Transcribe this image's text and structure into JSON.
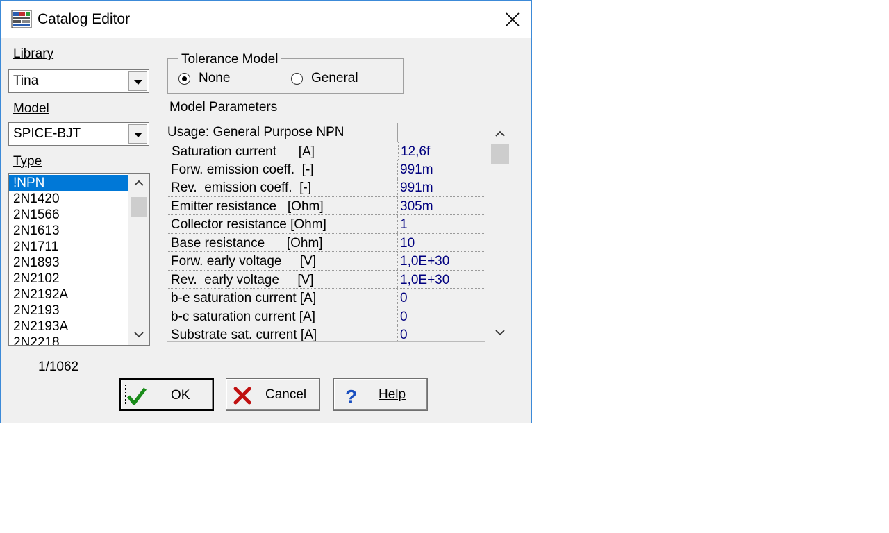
{
  "window": {
    "title": "Catalog Editor"
  },
  "library": {
    "label": "Library",
    "value": "Tina"
  },
  "model": {
    "label": "Model",
    "value": "SPICE-BJT"
  },
  "type": {
    "label": "Type",
    "items": [
      "!NPN",
      "2N1420",
      "2N1566",
      "2N1613",
      "2N1711",
      "2N1893",
      "2N2102",
      "2N2192A",
      "2N2193",
      "2N2193A",
      "2N2218"
    ],
    "selected_index": 0
  },
  "counter": "1/1062",
  "tolerance": {
    "title": "Tolerance Model",
    "none_label": "None",
    "general_label": "General",
    "selected": "None"
  },
  "params": {
    "label": "Model Parameters",
    "header": "Usage: General Purpose NPN",
    "rows": [
      {
        "name": "Saturation current      [A]",
        "value": "12,6f"
      },
      {
        "name": "Forw. emission coeff.  [-]",
        "value": "991m"
      },
      {
        "name": "Rev.  emission coeff.  [-]",
        "value": "991m"
      },
      {
        "name": "Emitter resistance   [Ohm]",
        "value": "305m"
      },
      {
        "name": "Collector resistance [Ohm]",
        "value": "1"
      },
      {
        "name": "Base resistance      [Ohm]",
        "value": "10"
      },
      {
        "name": "Forw. early voltage     [V]",
        "value": "1,0E+30"
      },
      {
        "name": "Rev.  early voltage     [V]",
        "value": "1,0E+30"
      },
      {
        "name": "b-e saturation current [A]",
        "value": "0"
      },
      {
        "name": "b-c saturation current [A]",
        "value": "0"
      },
      {
        "name": "Substrate sat. current [A]",
        "value": "0"
      }
    ]
  },
  "buttons": {
    "ok": "OK",
    "cancel": "Cancel",
    "help": "Help"
  },
  "colors": {
    "selection": "#0078d7",
    "value_text": "#00007f",
    "window_border": "#3c8ad8"
  }
}
